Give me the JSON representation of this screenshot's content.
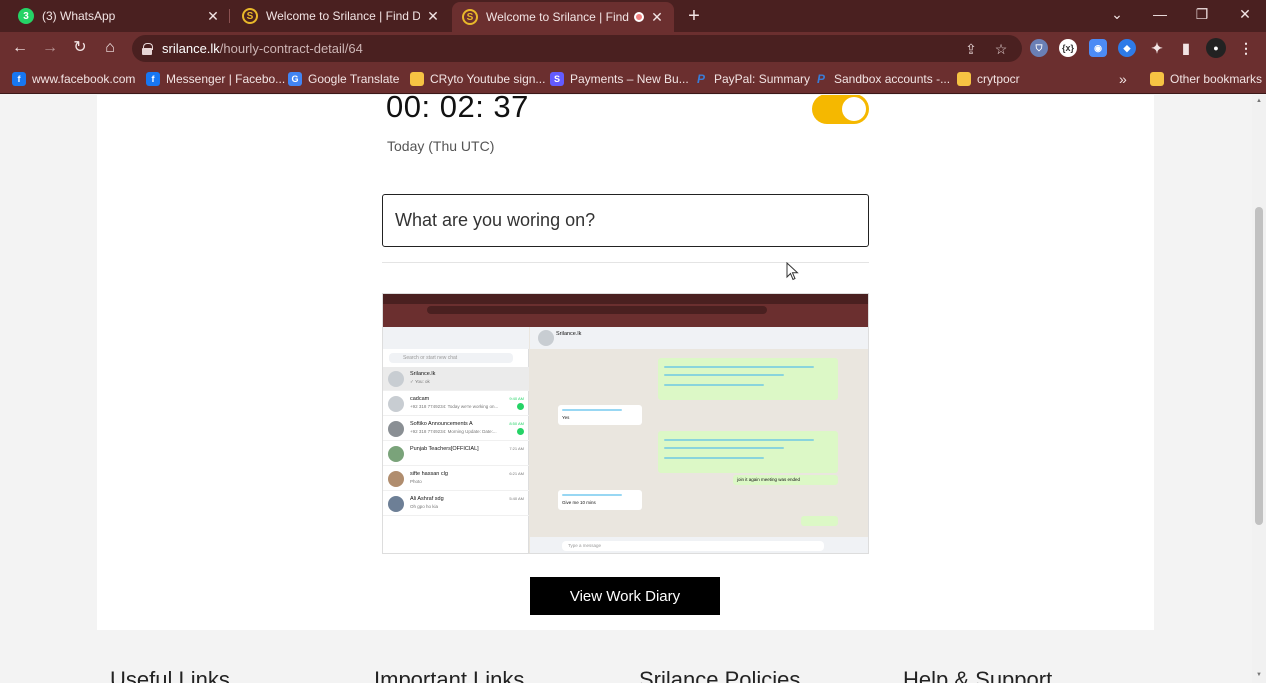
{
  "browser": {
    "tabs": [
      {
        "title": "(3) WhatsApp",
        "icon": "whatsapp-icon"
      },
      {
        "title": "Welcome to Srilance | Find Dream",
        "icon": "srilance-icon"
      },
      {
        "title": "Welcome to Srilance | Find D",
        "icon": "srilance-icon",
        "active": true,
        "recording": true
      }
    ],
    "url_host": "srilance.lk",
    "url_path": "/hourly-contract-detail/64",
    "bookmarks": [
      {
        "label": "www.facebook.com",
        "icon": "facebook-icon"
      },
      {
        "label": "Messenger | Facebo...",
        "icon": "facebook-icon"
      },
      {
        "label": "Google Translate",
        "icon": "google-translate-icon"
      },
      {
        "label": "CRyto Youtube sign...",
        "icon": "folder-icon"
      },
      {
        "label": "Payments – New Bu...",
        "icon": "stripe-icon"
      },
      {
        "label": "PayPal: Summary",
        "icon": "paypal-icon"
      },
      {
        "label": "Sandbox accounts -...",
        "icon": "paypal-icon"
      },
      {
        "label": "crytpocr",
        "icon": "folder-icon"
      }
    ],
    "overflow_label": "»",
    "other_bookmarks": "Other bookmarks",
    "tab_close_glyph": "✕",
    "new_tab_glyph": "+"
  },
  "tracker": {
    "timer": "00: 02: 37",
    "day_label": "Today (Thu UTC)",
    "tracking_on": true,
    "task_placeholder": "What are you woring on?",
    "accent_color": "#f5b800"
  },
  "screenshot": {
    "chat_header": "Srilance.lk",
    "search_placeholder": "Search or start new chat",
    "compose_placeholder": "Type a message",
    "chats": [
      {
        "name": "Srilance.lk",
        "msg": "✓ You: ok",
        "time": "",
        "selected": true
      },
      {
        "name": "cadcam",
        "msg": "+92 318 7749234: Today we're working on...",
        "time": "9:40 AM",
        "badge": true
      },
      {
        "name": "Softiko Announcements A",
        "msg": "+92 318 7749234: Morning Update: Date:...",
        "time": "8:50 AM",
        "badge": true
      },
      {
        "name": "Punjab Teachers[OFFICIAL]",
        "msg": "",
        "time": "7:21 AM"
      },
      {
        "name": "sifte hassan clg",
        "msg": "Photo",
        "time": "6:21 AM"
      },
      {
        "name": "Ali Ashraf sdg",
        "msg": "Oh gpo ho kia",
        "time": "5:40 AM"
      }
    ],
    "bubble_texts": [
      "Yes",
      "Give me 10 mins",
      "join it again meeting was ended"
    ]
  },
  "actions": {
    "view_diary": "View Work Diary"
  },
  "footer": {
    "columns": [
      "Useful Links",
      "Important Links",
      "Srilance Policies",
      "Help & Support"
    ]
  }
}
